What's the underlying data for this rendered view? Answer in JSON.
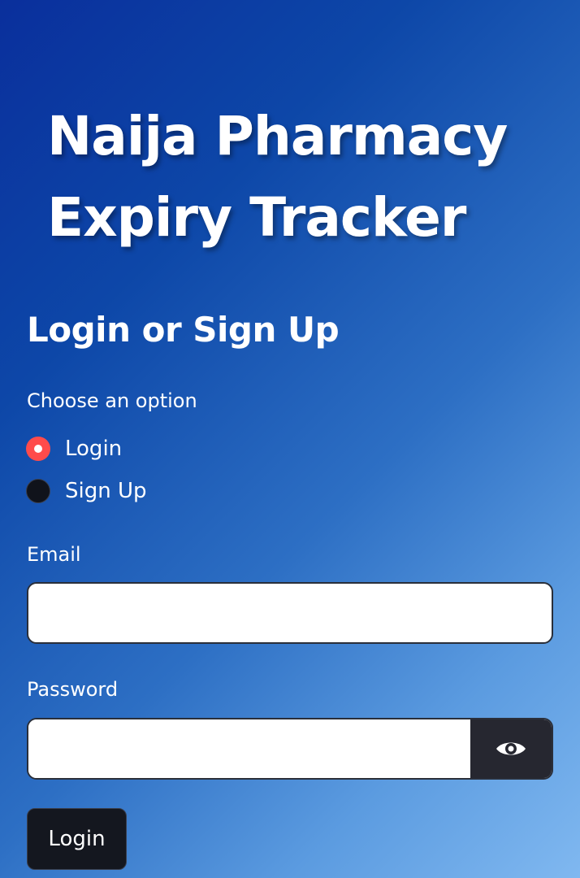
{
  "app": {
    "title_line1": "Naija Pharmacy",
    "title_line2": "Expiry Tracker"
  },
  "auth": {
    "heading": "Login or Sign Up",
    "option_label": "Choose an option",
    "options": [
      {
        "label": "Login",
        "selected": true
      },
      {
        "label": "Sign Up",
        "selected": false
      }
    ],
    "email": {
      "label": "Email",
      "value": "",
      "placeholder": ""
    },
    "password": {
      "label": "Password",
      "value": "",
      "placeholder": "",
      "toggle_icon": "eye-icon"
    },
    "submit_label": "Login"
  },
  "colors": {
    "accent": "#ff4b4b",
    "button_bg": "#14171f",
    "gradient_start": "#0a2f9c",
    "gradient_end": "#80b8f0"
  }
}
